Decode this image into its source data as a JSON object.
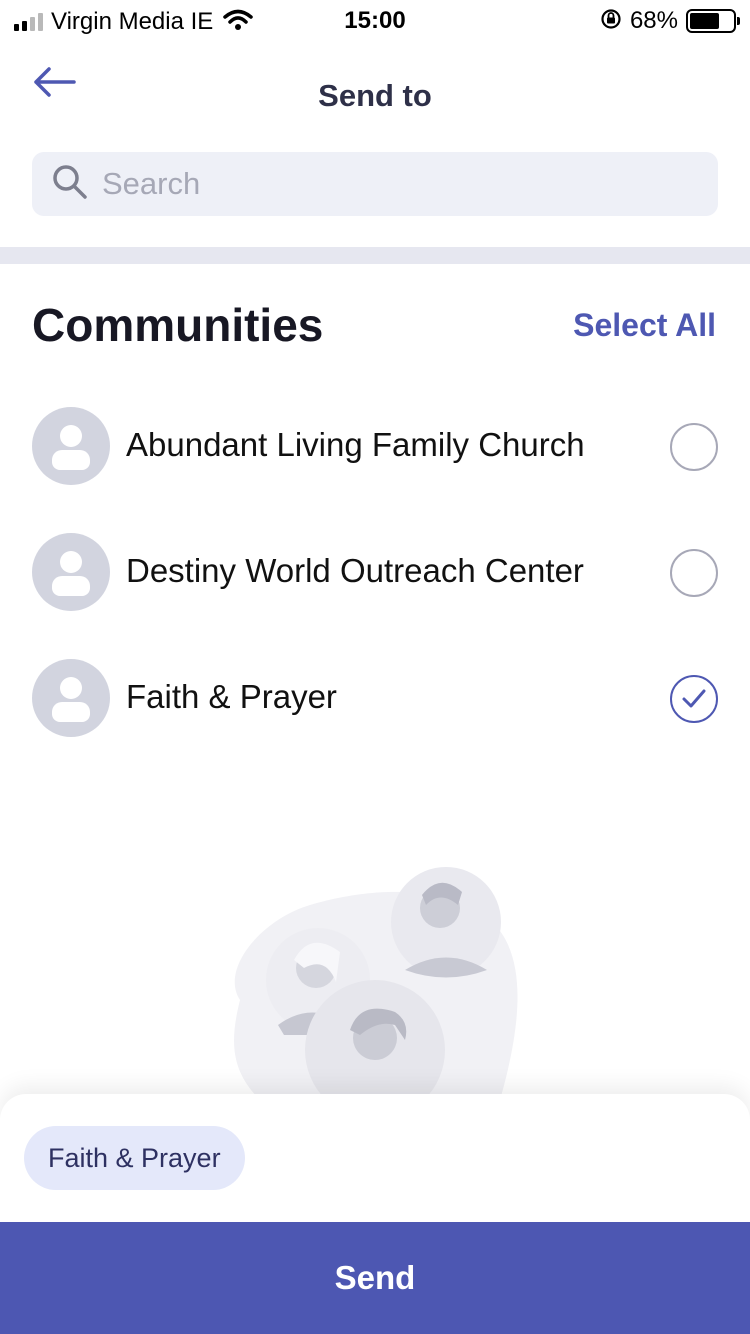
{
  "status_bar": {
    "carrier": "Virgin Media IE",
    "time": "15:00",
    "battery": "68%",
    "battery_level": 0.68,
    "icons": [
      "signal-icon",
      "wifi-icon",
      "orientation-lock-icon",
      "battery-icon"
    ]
  },
  "header": {
    "title": "Send to",
    "back_icon": "arrow-left-icon"
  },
  "search": {
    "placeholder": "Search",
    "value": "",
    "icon": "search-icon"
  },
  "section": {
    "title": "Communities",
    "select_all": "Select All"
  },
  "communities": [
    {
      "name": "Abundant Living Family Church",
      "selected": false
    },
    {
      "name": "Destiny World Outreach Center",
      "selected": false
    },
    {
      "name": "Faith & Prayer",
      "selected": true
    }
  ],
  "selected_chips": [
    "Faith & Prayer"
  ],
  "send_button": {
    "label": "Send"
  },
  "colors": {
    "accent": "#4d57b2",
    "search_bg": "#eef0f7",
    "chip_bg": "#e4e8fa",
    "avatar_bg": "#d2d4df"
  }
}
